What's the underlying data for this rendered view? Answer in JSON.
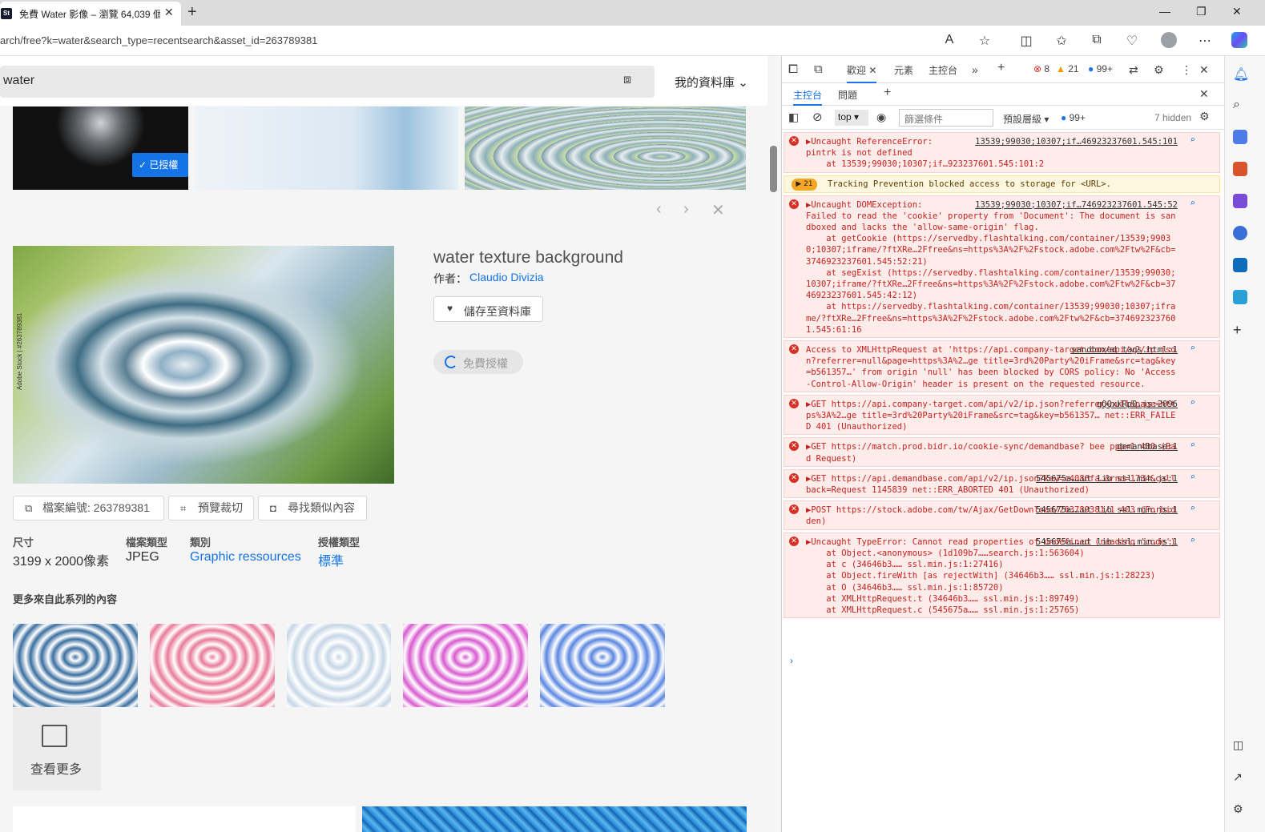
{
  "browser": {
    "tab_title": "免費 Water 影像 – 瀏覽 64,039 個",
    "url": "arch/free?k=water&search_type=recentsearch&asset_id=263789381"
  },
  "page": {
    "search_query": "water",
    "my_library": "我的資料庫",
    "licensed_badge": "已授權",
    "image_title": "water texture background",
    "author_label": "作者：",
    "author": "Claudio Divizia",
    "save_button": "儲存至資料庫",
    "free_license_button": "免費授權",
    "file_number_label": "檔案編號:",
    "file_number": "263789381",
    "preview_crop": "預覽裁切",
    "find_similar": "尋找類似內容",
    "watermark": "Adobe Stock | #263789381",
    "meta": [
      {
        "label": "尺寸",
        "value": "3199 x 2000像素",
        "link": false
      },
      {
        "label": "檔案類型",
        "value": "JPEG",
        "link": false
      },
      {
        "label": "類別",
        "value": "Graphic ressources",
        "link": true
      },
      {
        "label": "授權類型",
        "value": "標準",
        "link": true
      }
    ],
    "series_label": "更多來自此系列的內容",
    "see_more": "查看更多",
    "series_colors": [
      "#3a6fa0",
      "#e87a9a",
      "#c6d6e6",
      "#d85ad0",
      "#5a86e0"
    ]
  },
  "devtools": {
    "tabs": [
      "歡迎",
      "元素",
      "主控台"
    ],
    "error_count": "8",
    "warning_count": "21",
    "info_count": "99+",
    "subtabs": [
      "主控台",
      "問題"
    ],
    "context": "top",
    "filter_placeholder": "篩選條件",
    "level": "預設層級",
    "level_count": "99+",
    "hidden": "7 hidden",
    "messages": [
      {
        "type": "error",
        "src": "13539;99030;10307;if…46923237601.545:101",
        "text": "▶Uncaught ReferenceError:\npintrk is not defined\n    at 13539;99030;10307;if…923237601.545:101:2"
      },
      {
        "type": "warn",
        "count": "21",
        "text": "Tracking Prevention blocked access to storage for <URL>."
      },
      {
        "type": "error",
        "src": "13539;99030;10307;if…746923237601.545:52",
        "text": "▶Uncaught DOMException:\nFailed to read the 'cookie' property from 'Document': The document is sandboxed and lacks the 'allow-same-origin' flag.\n    at getCookie (https://servedby.flashtalking.com/container/13539;99030;10307;iframe/?ftXRe…2Ffree&ns=https%3A%2F%2Fstock.adobe.com%2Ftw%2F&cb=3746923237601.545:52:21)\n    at segExist (https://servedby.flashtalking.com/container/13539;99030;10307;iframe/?ftXRe…2Ffree&ns=https%3A%2F%2Fstock.adobe.com%2Ftw%2F&cb=3746923237601.545:42:12)\n    at https://servedby.flashtalking.com/container/13539;99030;10307;iframe/?ftXRe…2Ffree&ns=https%3A%2F%2Fstock.adobe.com%2Ftw%2F&cb=3746923237601.545:61:16"
      },
      {
        "type": "error",
        "src": "sandboxed tags.html:1",
        "text": "Access to XMLHttpRequest at 'https://api.company-target.com/api/v2/ip.json?referrer=null&page=https%3A%2…ge title=3rd%20Party%20iFrame&src=tag&key=b561357…' from origin 'null' has been blocked by CORS policy: No 'Access-Control-Allow-Origin' header is present on the requested resource."
      },
      {
        "type": "error",
        "src": "gQQxkRp0.js:2096",
        "text": "▶GET https://api.company-target.com/api/v2/ip.json?referrer=null&page=https%3A%2…ge title=3rd%20Party%20iFrame&src=tag&key=b561357… net::ERR_FAILED 401 (Unauthorized)"
      },
      {
        "type": "error",
        "src": "demandbase:1",
        "text": "▶GET https://match.prod.bidr.io/cookie-sync/demandbase? bee ppp=1 400 (Bad Request)"
      },
      {
        "type": "error",
        "src": "545675a……ut lib ssl.min.js:1",
        "text": "▶GET https://api.demandbase.com/api/v2/ip.json?key=e4086fa…&rnd=1734&callback=Request 1145839 net::ERR_ABORTED 401 (Unauthorized)"
      },
      {
        "type": "error",
        "src": "545675a……ut lib ssl.min.js:1",
        "text": "▶POST https://stock.adobe.com/tw/Ajax/GetDownload/263789381/1 403 (Forbidden)"
      },
      {
        "type": "error",
        "src": "545675a……ut lib ssl.min.js:1",
        "text": "▶Uncaught TypeError: Cannot read properties of undefined (reading 'code')\n    at Object.<anonymous> (1d109b7……search.js:1:563604)\n    at c (34646b3…… ssl.min.js:1:27416)\n    at Object.fireWith [as rejectWith] (34646b3…… ssl.min.js:1:28223)\n    at O (34646b3…… ssl.min.js:1:85720)\n    at XMLHttpRequest.t (34646b3…… ssl.min.js:1:89749)\n    at XMLHttpRequest.c (545675a…… ssl.min.js:1:25765)"
      }
    ],
    "prompt": "›"
  }
}
